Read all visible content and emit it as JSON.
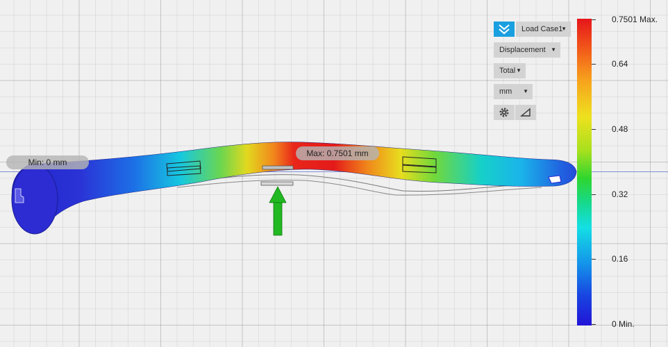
{
  "toolbar": {
    "load_case": "Load Case1",
    "result_type": "Displacement",
    "component": "Total",
    "units": "mm"
  },
  "probes": {
    "min_label": "Min: 0 mm",
    "max_label": "Max: 0.7501 mm"
  },
  "legend": {
    "ticks": [
      "0.7501 Max.",
      "0.64",
      "0.48",
      "0.32",
      "0.16",
      "0 Min."
    ],
    "values": [
      0.7501,
      0.64,
      0.48,
      0.32,
      0.16,
      0
    ]
  },
  "colors": {
    "accent": "#1aa0e0",
    "load_arrow": "#22b822",
    "model_low": "#2a2ad0",
    "model_high": "#e41a1a"
  },
  "icons": [
    "load-case-icon",
    "gear-icon",
    "triangle-icon",
    "load-arrow-icon"
  ]
}
